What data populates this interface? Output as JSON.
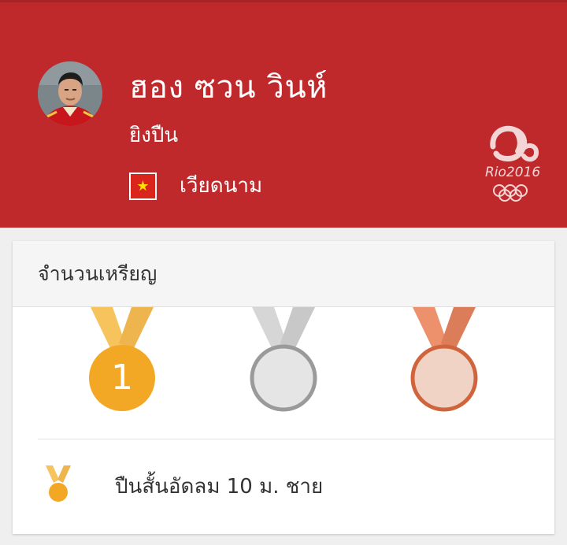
{
  "athlete": {
    "name": "ฮอง ซวน วินห์",
    "sport": "ยิงปืน",
    "country": "เวียดนาม",
    "flag_star": "★",
    "flag_icon": "vietnam-flag-icon",
    "avatar_icon": "athlete-photo"
  },
  "branding": {
    "logo_text": "Rio2016",
    "logo_icon": "rio-2016-olympic-logo"
  },
  "colors": {
    "header_bg": "#c0292c",
    "gold": "#f2a825",
    "silver": "#e5e5e5",
    "bronze": "#f0d3c5"
  },
  "medals": {
    "title": "จำนวนเหรียญ",
    "gold": "1",
    "silver": "",
    "bronze": ""
  },
  "events": [
    {
      "name": "ปืนสั้นอัดลม 10 ม. ชาย",
      "medal": "gold"
    }
  ]
}
